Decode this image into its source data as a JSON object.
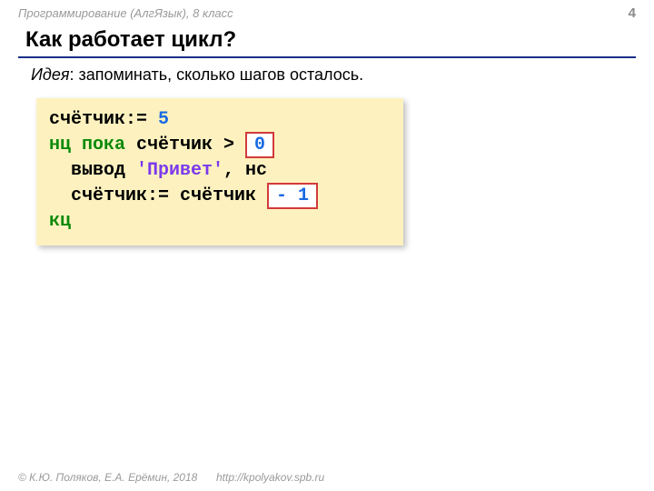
{
  "header": {
    "course": "Программирование (АлгЯзык), 8 класс",
    "page": "4"
  },
  "title": "Как работает цикл?",
  "idea": {
    "label": "Идея",
    "text": ": запоминать, сколько шагов осталось."
  },
  "code": {
    "l1a": "счётчик:= ",
    "l1b": "5",
    "l2a": "нц пока",
    "l2b": " счётчик > ",
    "l2c": "0",
    "l3a": "  вывод ",
    "l3b": "'Привет'",
    "l3c": ", нс",
    "l4a": "  счётчик:= счётчик ",
    "l4b": "- 1",
    "l5": "кц"
  },
  "footer": {
    "copyright": "© К.Ю. Поляков, Е.А. Ерёмин, 2018",
    "url": "http://kpolyakov.spb.ru"
  }
}
